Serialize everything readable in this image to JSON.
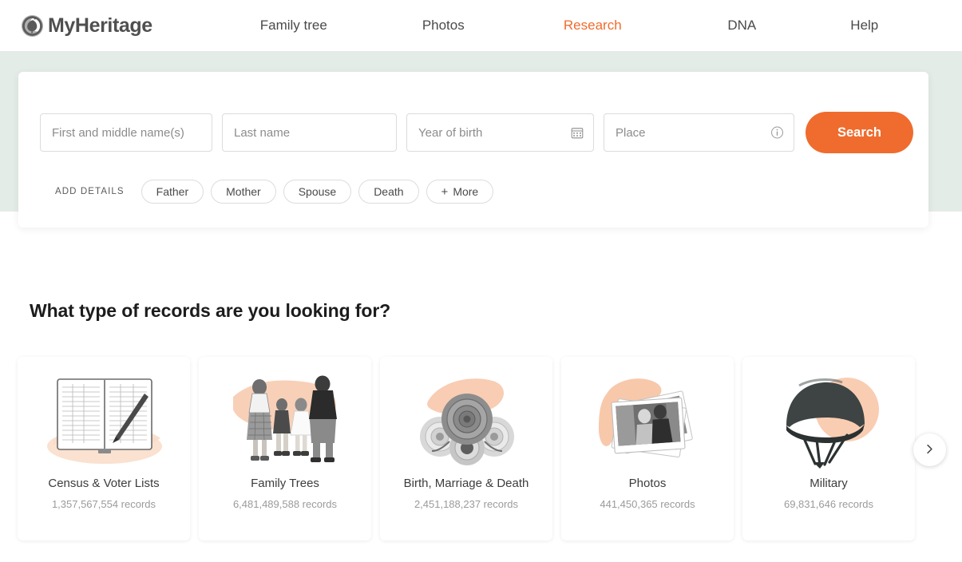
{
  "header": {
    "logo": {
      "mark_icon": "myheritage-circle-leaf-icon",
      "text": "MyHeritage"
    },
    "nav": [
      {
        "label": "Family tree",
        "active": false
      },
      {
        "label": "Photos",
        "active": false
      },
      {
        "label": "Research",
        "active": true
      },
      {
        "label": "DNA",
        "active": false
      },
      {
        "label": "Help",
        "active": false
      }
    ],
    "accent_color": "#ef6c2e",
    "text_color": "#4a4a4a"
  },
  "hero": {
    "band_color": "#e4ece8",
    "search_form": {
      "fields": [
        {
          "name": "first-name",
          "placeholder": "First and middle name(s)",
          "value": "",
          "icon": null
        },
        {
          "name": "last-name",
          "placeholder": "Last name",
          "value": "",
          "icon": null
        },
        {
          "name": "year-of-birth",
          "placeholder": "Year of birth",
          "value": "",
          "icon": "calendar-icon"
        },
        {
          "name": "place",
          "placeholder": "Place",
          "value": "",
          "icon": "info-icon"
        }
      ],
      "search_button": "Search",
      "search_button_color": "#ef6c2e",
      "add_details_label": "ADD DETAILS",
      "chips": [
        {
          "label": "Father"
        },
        {
          "label": "Mother"
        },
        {
          "label": "Spouse"
        },
        {
          "label": "Death"
        },
        {
          "label": "More",
          "prefix": "+"
        }
      ]
    }
  },
  "records_section": {
    "title": "What type of records are you looking for?",
    "cards": [
      {
        "label": "Census & Voter Lists",
        "count": "1,357,567,554 records",
        "art_icon": "open-ledger-book-with-pen-icon"
      },
      {
        "label": "Family Trees",
        "count": "6,481,489,588 records",
        "art_icon": "family-of-four-walking-icon"
      },
      {
        "label": "Birth, Marriage & Death",
        "count": "2,451,188,237 records",
        "art_icon": "roses-bouquet-icon"
      },
      {
        "label": "Photos",
        "count": "441,450,365 records",
        "art_icon": "stack-of-photographs-icon"
      },
      {
        "label": "Military",
        "count": "69,831,646 records",
        "art_icon": "military-helmet-icon"
      }
    ],
    "next_arrow_icon": "chevron-right-icon"
  }
}
